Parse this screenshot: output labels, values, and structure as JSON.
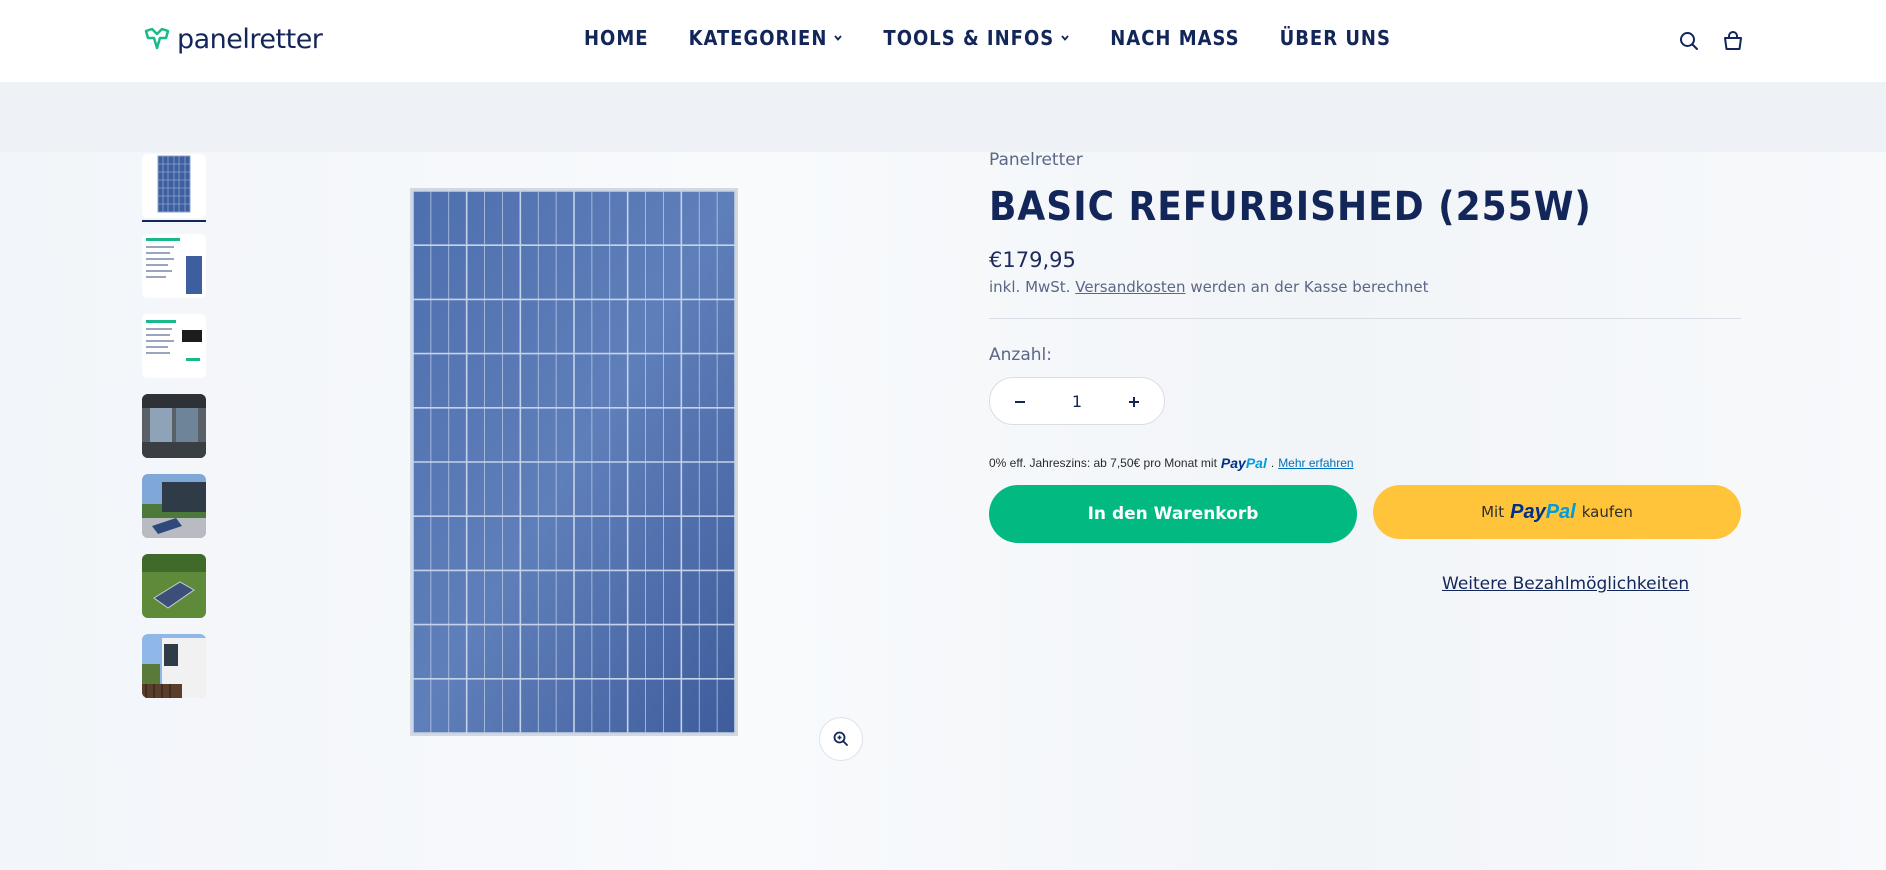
{
  "brand": {
    "name": "panelretter"
  },
  "nav": {
    "items": [
      {
        "label": "HOME",
        "dropdown": false
      },
      {
        "label": "KATEGORIEN",
        "dropdown": true
      },
      {
        "label": "TOOLS & INFOS",
        "dropdown": true
      },
      {
        "label": "NACH MASS",
        "dropdown": false
      },
      {
        "label": "ÜBER UNS",
        "dropdown": false
      }
    ]
  },
  "header_icons": [
    "search-icon",
    "cart-icon"
  ],
  "product": {
    "vendor": "Panelretter",
    "title": "BASIC REFURBISHED (255W)",
    "price": "€179,95",
    "tax_prefix": "inkl. MwSt.",
    "tax_link": "Versandkosten",
    "tax_suffix": "werden an der Kasse berechnet",
    "quantity_label": "Anzahl:",
    "quantity": "1",
    "paypal_info_text": "0% eff. Jahreszins: ab 7,50€ pro Monat mit",
    "paypal_info_link": "Mehr erfahren",
    "add_to_cart": "In den Warenkorb",
    "paypal_button_prefix": "Mit",
    "paypal_button_suffix": "kaufen",
    "more_payment": "Weitere Bezahlmöglichkeiten"
  },
  "paypal_logo": {
    "pay": "Pay",
    "pal": "Pal"
  },
  "thumbnails": [
    "solar-panel-front",
    "spec-sheet",
    "spec-sheet-2",
    "window-installation",
    "terrace-installation",
    "lawn-installation",
    "balcony-installation"
  ],
  "colors": {
    "primary_text": "#13265a",
    "cart_button": "#03b982",
    "paypal_button": "#ffc439"
  }
}
